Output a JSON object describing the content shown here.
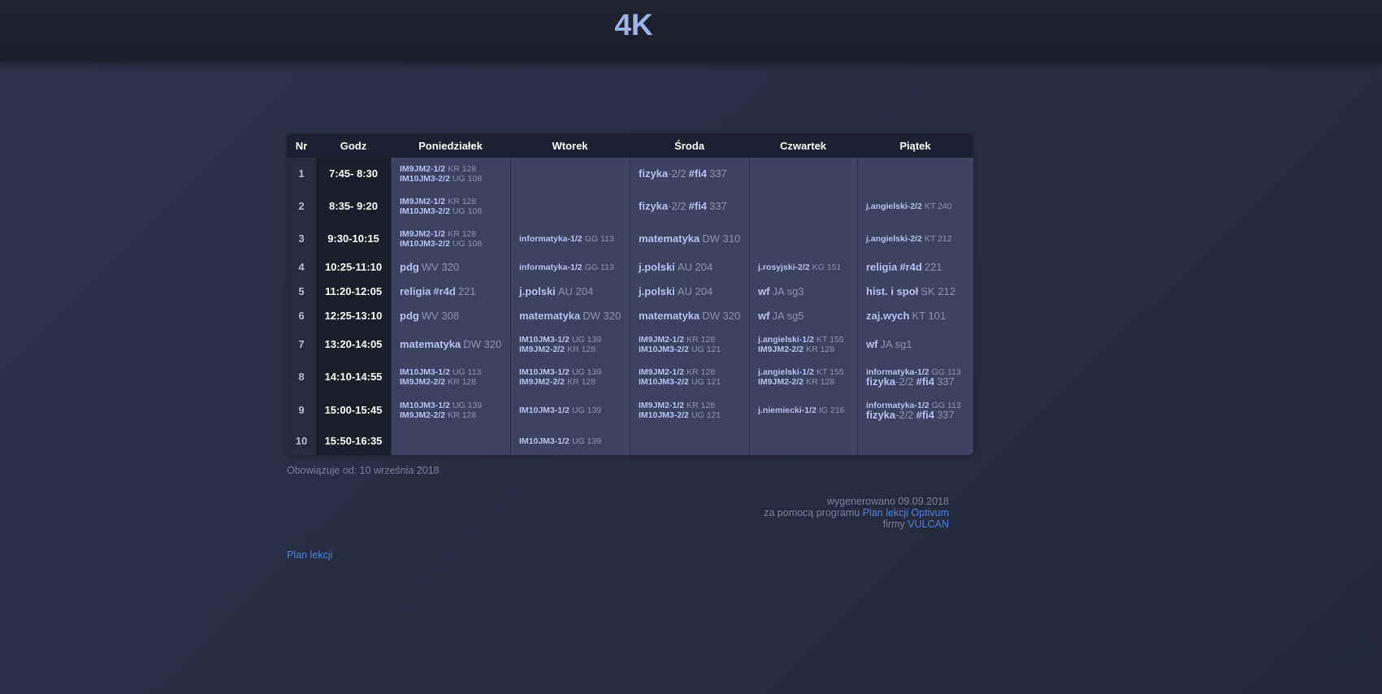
{
  "header": {
    "title": "4K"
  },
  "table": {
    "columns": [
      "Nr",
      "Godz",
      "Poniedziałek",
      "Wtorek",
      "Środa",
      "Czwartek",
      "Piątek"
    ],
    "rows": [
      {
        "nr": "1",
        "time": "7:45- 8:30",
        "h": 40,
        "cells": [
          {
            "size": "small",
            "lines": [
              {
                "name": "IM9JM2-1/2",
                "room": "KR 128"
              },
              {
                "name": "IM10JM3-2/2",
                "room": "UG 108"
              }
            ]
          },
          {
            "lines": []
          },
          {
            "size": "big",
            "lines": [
              {
                "name": "fizyka",
                "suffix": "-2/2",
                "group": "#fi4",
                "room": "337"
              }
            ]
          },
          {
            "lines": []
          },
          {
            "lines": []
          }
        ]
      },
      {
        "nr": "2",
        "time": "8:35- 9:20",
        "h": 40,
        "cells": [
          {
            "size": "small",
            "lines": [
              {
                "name": "IM9JM2-1/2",
                "room": "KR 128"
              },
              {
                "name": "IM10JM3-2/2",
                "room": "UG 108"
              }
            ]
          },
          {
            "lines": []
          },
          {
            "size": "big",
            "lines": [
              {
                "name": "fizyka",
                "suffix": "-2/2",
                "group": "#fi4",
                "room": "337"
              }
            ]
          },
          {
            "lines": []
          },
          {
            "size": "small",
            "lines": [
              {
                "name": "j.angielski-2/2",
                "room": "KT 240"
              }
            ]
          }
        ]
      },
      {
        "nr": "3",
        "time": "9:30-10:15",
        "h": 40,
        "cells": [
          {
            "size": "small",
            "lines": [
              {
                "name": "IM9JM2-1/2",
                "room": "KR 128"
              },
              {
                "name": "IM10JM3-2/2",
                "room": "UG 108"
              }
            ]
          },
          {
            "size": "small",
            "lines": [
              {
                "name": "informatyka-1/2",
                "room": "GG 113"
              }
            ]
          },
          {
            "size": "big",
            "lines": [
              {
                "name": "matematyka",
                "room": "DW 310"
              }
            ]
          },
          {
            "lines": []
          },
          {
            "size": "small",
            "lines": [
              {
                "name": "j.angielski-2/2",
                "room": "KT 212"
              }
            ]
          }
        ]
      },
      {
        "nr": "4",
        "time": "10:25-11:10",
        "h": 30,
        "cells": [
          {
            "size": "big",
            "lines": [
              {
                "name": "pdg",
                "room": "WV 320"
              }
            ]
          },
          {
            "size": "small",
            "lines": [
              {
                "name": "informatyka-1/2",
                "room": "GG 113"
              }
            ]
          },
          {
            "size": "big",
            "lines": [
              {
                "name": "j.polski",
                "room": "AU 204"
              }
            ]
          },
          {
            "size": "small",
            "lines": [
              {
                "name": "j.rosyjski-2/2",
                "room": "KG 151"
              }
            ]
          },
          {
            "size": "big",
            "lines": [
              {
                "name": "religia",
                "group": "#r4d",
                "room": "221"
              }
            ]
          }
        ]
      },
      {
        "nr": "5",
        "time": "11:20-12:05",
        "h": 30,
        "cells": [
          {
            "size": "big",
            "lines": [
              {
                "name": "religia",
                "group": "#r4d",
                "room": "221"
              }
            ]
          },
          {
            "size": "big",
            "lines": [
              {
                "name": "j.polski",
                "room": "AU 204"
              }
            ]
          },
          {
            "size": "big",
            "lines": [
              {
                "name": "j.polski",
                "room": "AU 204"
              }
            ]
          },
          {
            "size": "big",
            "lines": [
              {
                "name": "wf",
                "room": "JA sg3"
              }
            ]
          },
          {
            "size": "big",
            "lines": [
              {
                "name": "hist. i społ",
                "room": "SK 212"
              }
            ]
          }
        ]
      },
      {
        "nr": "6",
        "time": "12:25-13:10",
        "h": 30,
        "cells": [
          {
            "size": "big",
            "lines": [
              {
                "name": "pdg",
                "room": "WV 308"
              }
            ]
          },
          {
            "size": "big",
            "lines": [
              {
                "name": "matematyka",
                "room": "DW 320"
              }
            ]
          },
          {
            "size": "big",
            "lines": [
              {
                "name": "matematyka",
                "room": "DW 320"
              }
            ]
          },
          {
            "size": "big",
            "lines": [
              {
                "name": "wf",
                "room": "JA sg5"
              }
            ]
          },
          {
            "size": "big",
            "lines": [
              {
                "name": "zaj.wych",
                "room": "KT 101"
              }
            ]
          }
        ]
      },
      {
        "nr": "7",
        "time": "13:20-14:05",
        "h": 40,
        "cells": [
          {
            "size": "big",
            "lines": [
              {
                "name": "matematyka",
                "room": "DW 320"
              }
            ]
          },
          {
            "size": "small",
            "lines": [
              {
                "name": "IM10JM3-1/2",
                "room": "UG 139"
              },
              {
                "name": "IM9JM2-2/2",
                "room": "KR 128"
              }
            ]
          },
          {
            "size": "small",
            "lines": [
              {
                "name": "IM9JM2-1/2",
                "room": "KR 128"
              },
              {
                "name": "IM10JM3-2/2",
                "room": "UG 121"
              }
            ]
          },
          {
            "size": "small",
            "lines": [
              {
                "name": "j.angielski-1/2",
                "room": "KT 155"
              },
              {
                "name": "IM9JM2-2/2",
                "room": "KR 128"
              }
            ]
          },
          {
            "size": "big",
            "lines": [
              {
                "name": "wf",
                "room": "JA sg1"
              }
            ]
          }
        ]
      },
      {
        "nr": "8",
        "time": "14:10-14:55",
        "h": 40,
        "cells": [
          {
            "size": "small",
            "lines": [
              {
                "name": "IM10JM3-1/2",
                "room": "UG 113"
              },
              {
                "name": "IM9JM2-2/2",
                "room": "KR 128"
              }
            ]
          },
          {
            "size": "small",
            "lines": [
              {
                "name": "IM10JM3-1/2",
                "room": "UG 139"
              },
              {
                "name": "IM9JM2-2/2",
                "room": "KR 128"
              }
            ]
          },
          {
            "size": "small",
            "lines": [
              {
                "name": "IM9JM2-1/2",
                "room": "KR 128"
              },
              {
                "name": "IM10JM3-2/2",
                "room": "UG 121"
              }
            ]
          },
          {
            "size": "small",
            "lines": [
              {
                "name": "j.angielski-1/2",
                "room": "KT 155"
              },
              {
                "name": "IM9JM2-2/2",
                "room": "KR 128"
              }
            ]
          },
          {
            "size": "mixed",
            "lines": [
              {
                "name": "informatyka-1/2",
                "room": "GG 113",
                "size": "small"
              },
              {
                "name": "fizyka",
                "suffix": "-2/2",
                "group": "#fi4",
                "room": "337",
                "size": "big"
              }
            ]
          }
        ]
      },
      {
        "nr": "9",
        "time": "15:00-15:45",
        "h": 42,
        "cells": [
          {
            "size": "small",
            "lines": [
              {
                "name": "IM10JM3-1/2",
                "room": "UG 139"
              },
              {
                "name": "IM9JM2-2/2",
                "room": "KR 128"
              }
            ]
          },
          {
            "size": "small",
            "lines": [
              {
                "name": "IM10JM3-1/2",
                "room": "UG 139"
              }
            ]
          },
          {
            "size": "small",
            "lines": [
              {
                "name": "IM9JM2-1/2",
                "room": "KR 128"
              },
              {
                "name": "IM10JM3-2/2",
                "room": "UG 121"
              }
            ]
          },
          {
            "size": "small",
            "lines": [
              {
                "name": "j.niemiecki-1/2",
                "room": "IG 216"
              }
            ]
          },
          {
            "size": "mixed",
            "lines": [
              {
                "name": "informatyka-1/2",
                "room": "GG 113",
                "size": "small"
              },
              {
                "name": "fizyka",
                "suffix": "-2/2",
                "group": "#fi4",
                "room": "337",
                "size": "big"
              }
            ]
          }
        ]
      },
      {
        "nr": "10",
        "time": "15:50-16:35",
        "h": 34,
        "cells": [
          {
            "lines": []
          },
          {
            "size": "small",
            "lines": [
              {
                "name": "IM10JM3-1/2",
                "room": "UG 139"
              }
            ]
          },
          {
            "lines": []
          },
          {
            "lines": []
          },
          {
            "lines": []
          }
        ]
      }
    ]
  },
  "footer": {
    "valid_from": "Obowiązuje od: 10 września 2018",
    "generated": "wygenerowano 09.09.2018",
    "with_program_prefix": "za pomocą programu ",
    "program_link": "Plan lekcji Optivum",
    "company_prefix": "firmy ",
    "company_link": "VULCAN",
    "plan_link": "Plan lekcji"
  },
  "colors": {
    "background": "#282d42",
    "header_bg": "#1d2030",
    "cell_bg": "#3c4260",
    "link": "#4f7fd8",
    "title": "#9fb4e8"
  }
}
